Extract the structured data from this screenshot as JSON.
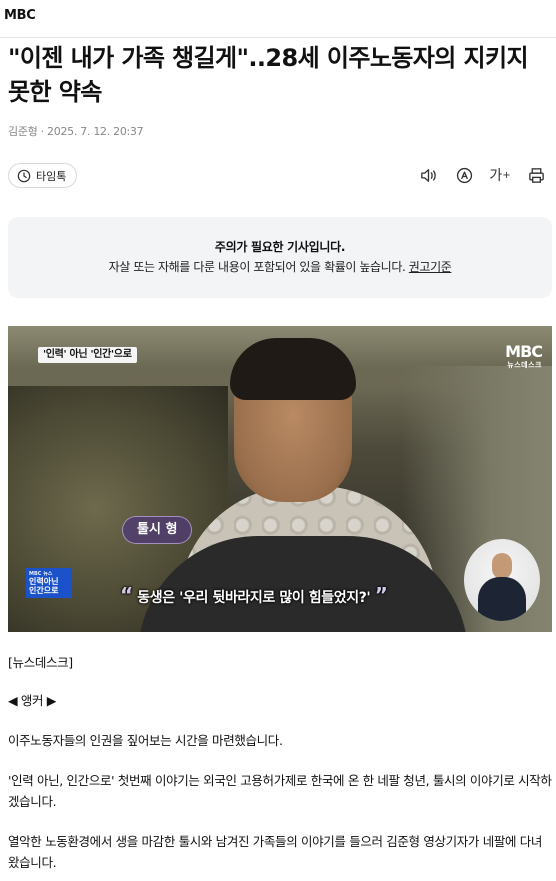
{
  "header": {
    "brand": "MBC"
  },
  "article": {
    "title": "\"이젠 내가 가족 챙길게\"..28세 이주노동자의 지키지 못한 약속",
    "byline": "김준형 · 2025. 7. 12. 20:37"
  },
  "toolbar": {
    "timetalk_label": "타임톡",
    "font_size_label": "가"
  },
  "notice": {
    "title": "주의가 필요한 기사입니다.",
    "body": "자살 또는 자해를 다룬 내용이 포함되어 있을 확률이 높습니다.",
    "link": "권고기준"
  },
  "video": {
    "program_tag": "'인력' 아닌 '인간'으로",
    "logo_main": "MBC",
    "logo_sub": "뉴스데스크",
    "name_tag": "툴시 형",
    "subtitle": "동생은 '우리 뒷바라지로 많이 힘들었지?'",
    "bug_top": "MBC 뉴스",
    "bug_line1": "인력아닌",
    "bug_line2": "인간으로"
  },
  "body": {
    "section": "[뉴스데스크]",
    "anchor": "◀ 앵커 ▶",
    "p1": "이주노동자들의 인권을 짚어보는 시간을 마련했습니다.",
    "p2": "'인력 아닌, 인간으로' 첫번째 이야기는 외국인 고용허가제로 한국에 온 한 네팔 청년, 툴시의 이야기로 시작하겠습니다.",
    "p3": "열악한 노동환경에서 생을 마감한 툴시와 남겨진 가족들의 이야기를 들으러 김준형 영상기자가 네팔에 다녀왔습니다."
  }
}
